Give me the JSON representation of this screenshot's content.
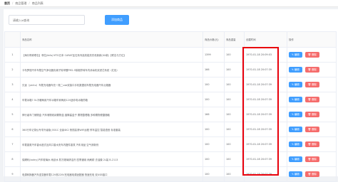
{
  "breadcrumb": [
    "首页",
    "商品管理",
    "商品列表"
  ],
  "search": {
    "placeholder": "请输入id查询"
  },
  "add_button": "添加商品",
  "table": {
    "headers": [
      "",
      "商品名称",
      "商品价格(元)",
      "商品重量",
      "创建时间",
      "操作"
    ],
    "rows": [
      {
        "idx": "1",
        "name": "【海尔佩奇联名】菲拉(fafa) MTG日本 CARAT钻石系列高效能洗衣机新款(XX款)【联名与方位】",
        "price": "1399",
        "weight": "100",
        "time": "1970-01-18 20:09:03"
      },
      {
        "idx": "2",
        "name": "卡布罗德汽车车载空气净化器负离子除甲醛PM2.5除烟异味车内消毒机双滤芯系统（红色）",
        "price": "166",
        "weight": "100",
        "time": "1970-01-18 20:07:39"
      },
      {
        "idx": "3",
        "name": "贝途（yentu）车载充电器车充一拖二usb双接口手机数据线车载充电器汽车点烟器",
        "price": "100",
        "weight": "100",
        "time": "1970-01-18 20:07:39"
      },
      {
        "idx": "4",
        "name": "车载冰箱7.5L冷暖两用汽车冰箱车家两用12V迷你电冰箱药箱",
        "price": "100",
        "weight": "100",
        "time": "1970-01-18 20:07:39"
      },
      {
        "idx": "5",
        "name": "神行者车门储物盒 汽车储物收纳置物盒 缝隙塞盒子 置物整理箱 多种置物便捷随取",
        "price": "166",
        "weight": "100",
        "time": "1970-01-18 20:07:39"
      },
      {
        "idx": "6",
        "name": "360行车记录仪专享升级版 J501C 全景4K2 夜视高清WiFi远程 停车监控 智能语音 标准套装",
        "price": "100",
        "weight": "100",
        "time": "1970-01-18 20:07:39"
      },
      {
        "idx": "7",
        "name": "车载香薰汽车香水座式出风口香水夹车内摆件香氛 汽车用品 空气清新剂",
        "price": "100",
        "weight": "100",
        "time": "1970-01-18 20:07:39"
      },
      {
        "idx": "8",
        "name": "保赐利(botny)汽车玻璃水 雨刮水 防冻玻璃清洁剂 四季通用 雨刷精 去油膜 2L装 B-2113",
        "price": "100",
        "weight": "100",
        "time": "1970-01-18 20:07:39"
      },
      {
        "idx": "9",
        "name": "电源转换器汽车逆变器车载12V转220V充电器电源适配器 快速充电 双USB接口",
        "price": "100",
        "weight": "100",
        "time": "1970-01-18 20:07:39"
      }
    ],
    "edit_label": "✎ 编辑",
    "delete_label": "🗑 删除"
  },
  "colors": {
    "primary": "#409eff",
    "danger": "#f56c6c",
    "highlight": "#e8000b"
  }
}
